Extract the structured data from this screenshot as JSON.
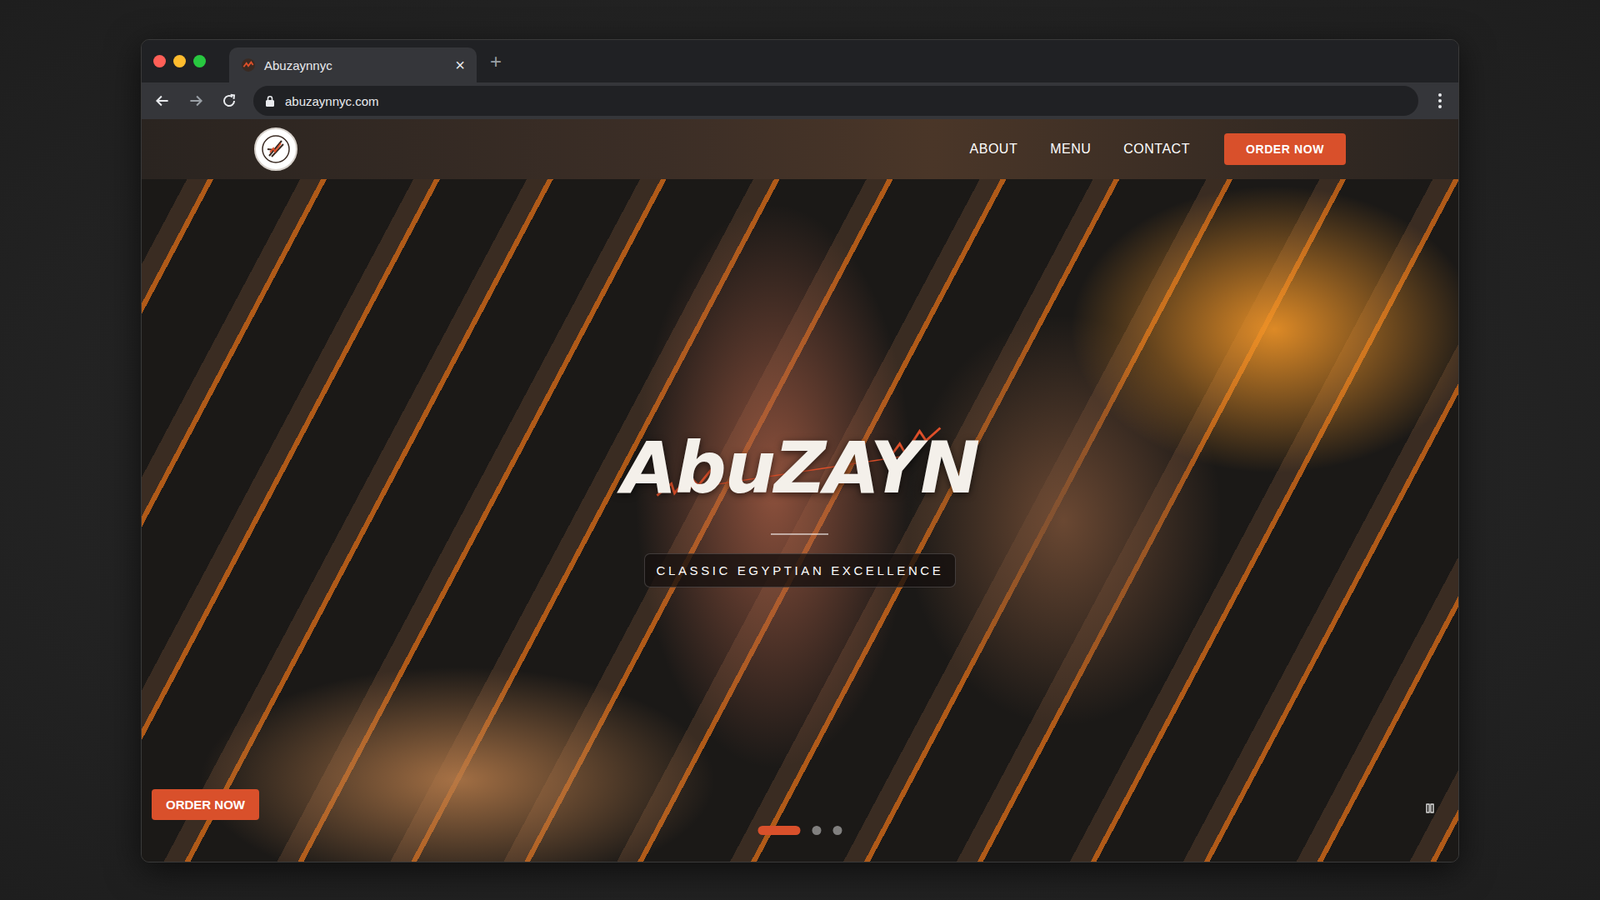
{
  "window": {
    "url": "abuzaynnyc.com",
    "new_tab": "+"
  },
  "tabs": [
    {
      "label": "Abuzaynnyc",
      "selected": true,
      "close": "×"
    }
  ],
  "nav": {
    "items": [
      {
        "label": "ABOUT"
      },
      {
        "label": "MENU"
      },
      {
        "label": "CONTACT"
      }
    ],
    "cta": "ORDER NOW"
  },
  "hero": {
    "logo": "AbuZAYN",
    "tagline": "CLASSIC EGYPTIAN EXCELLENCE",
    "order_button": "ORDER NOW",
    "slides": [
      {
        "selected": true
      },
      {
        "selected": false
      },
      {
        "selected": false
      }
    ],
    "paused": false
  }
}
